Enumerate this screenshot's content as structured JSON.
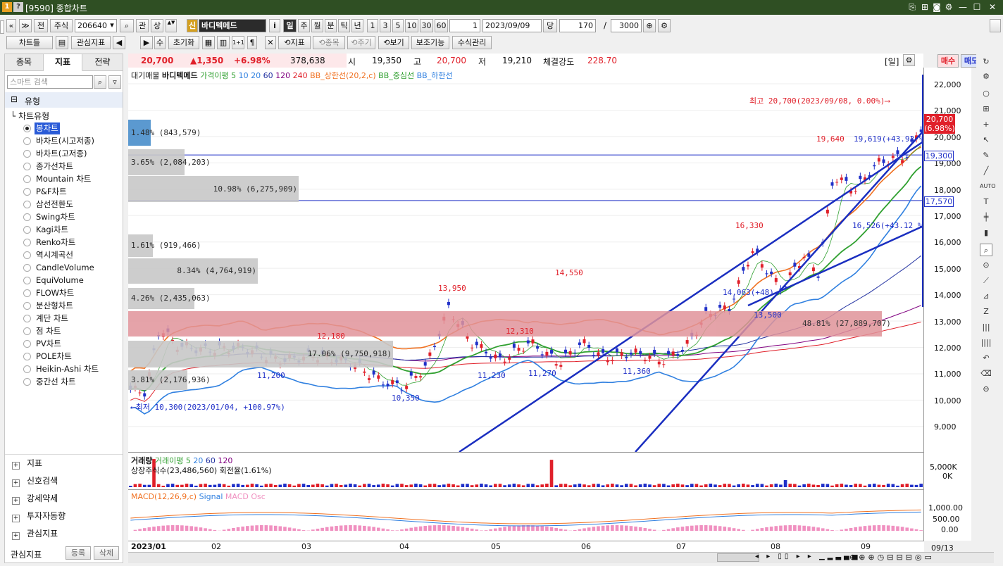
{
  "window": {
    "badge1": "1",
    "badge2": "?",
    "title": "[9590] 종합차트",
    "controls": [
      "⎘",
      "⊞",
      "◙",
      "⚙",
      "—",
      "☐",
      "✕"
    ]
  },
  "toolbar1": {
    "prev_label": "«",
    "up_label": "≫",
    "jeon": "전",
    "jusik": "주식",
    "code": "206640",
    "search_icon_label": "⌕",
    "gwan": "관",
    "sang": "상",
    "stepper": "▲▼",
    "sin": "신",
    "name": "바디텍메드",
    "info": "i",
    "periods": [
      "일",
      "주",
      "월",
      "분",
      "틱",
      "년"
    ],
    "nums": [
      "1",
      "3",
      "5",
      "10",
      "30",
      "60"
    ],
    "period_val": "1",
    "date": "2023/09/09",
    "dang": "당",
    "count": "170",
    "slash": "/",
    "max": "3000"
  },
  "toolbar2": {
    "charttool": "차트틀",
    "save_icon": "▤",
    "interest": "관심지표",
    "left_arrow": "◀",
    "right_arrow": "▶",
    "su": "수",
    "reset": "초기화",
    "grid1": "▦",
    "grid2": "▥",
    "grid3": "1+1",
    "x": "✕",
    "indicator": "지표",
    "item": "종목",
    "cycle": "주기",
    "view": "보기",
    "assist": "보조기능",
    "formula": "수식관리"
  },
  "left": {
    "tabs": [
      "종목",
      "지표",
      "전략"
    ],
    "search_placeholder": "스마트 검색",
    "type_header": "유형",
    "chart_type_label": "차트유형",
    "chart_types": [
      "봉차트",
      "바차트(시고저종)",
      "바차트(고저종)",
      "종가선차트",
      "Mountain 차트",
      "P&F차트",
      "삼선전환도",
      "Swing차트",
      "Kagi차트",
      "Renko차트",
      "역시계곡선",
      "CandleVolume",
      "EquiVolume",
      "FLOW차트",
      "분산형차트",
      "계단 차트",
      "점 차트",
      "PV차트",
      "POLE차트",
      "Heikin-Ashi 차트",
      "중간선 차트"
    ],
    "trees": [
      "지표",
      "신호검색",
      "강세약세",
      "투자자동향",
      "관심지표"
    ],
    "bottom_label": "관심지표",
    "reg": "등록",
    "del": "삭제"
  },
  "quote": {
    "price": "20,700",
    "change": "▲1,350",
    "rate": "+6.98%",
    "volume": "378,638",
    "open_l": "시",
    "open": "19,350",
    "high_l": "고",
    "high": "20,700",
    "low_l": "저",
    "low": "19,210",
    "str_l": "체결강도",
    "strength": "228.70",
    "period": "[일]",
    "buy": "매수",
    "sell": "매도"
  },
  "legend_price": {
    "a": "대기매물",
    "b": "바디텍메드",
    "c": "가격이평 5",
    "d": "10",
    "e": "20",
    "f": "60",
    "g": "120",
    "h": "240",
    "i": "BB_상한선(20,2,c)",
    "j": "BB_중심선",
    "k": "BB_하한선"
  },
  "annotations": {
    "max_text": "최고 20,700(2023/09/08, 0.00%)⟶",
    "min_text": "⟵최저 10,300(2023/01/04, +100.97%)",
    "p19640": "19,640",
    "p19619": "19,619(+43.93 %)",
    "p16526": "16,526(+43.12 %)",
    "p16330": "16,330",
    "p14550": "14,550",
    "p13950": "13,950",
    "p14063": "14,063(+48)",
    "p13500": "13,500",
    "p12310": "12,310",
    "p12180": "12,180",
    "p11200": "11,200",
    "p11230": "11,230",
    "p11270": "11,270",
    "p11360": "11,360",
    "p10350": "10,350"
  },
  "volume_profile": [
    {
      "label": "1.48% (843,579)",
      "w": 32,
      "color": "#4a8fcc"
    },
    {
      "label": "3.65% (2,084,203)",
      "w": 80,
      "color": "#c8c8c8"
    },
    {
      "label": "10.98% (6,275,909)",
      "w": 242,
      "color": "#c8c8c8"
    },
    {
      "label": "1.61% (919,466)",
      "w": 35,
      "color": "#c8c8c8"
    },
    {
      "label": "8.34% (4,764,919)",
      "w": 184,
      "color": "#c8c8c8"
    },
    {
      "label": "4.26% (2,435,063)",
      "w": 94,
      "color": "#c8c8c8"
    },
    {
      "label": "48.81% (27,889,707)",
      "w": 1070,
      "color": "#e0939a"
    },
    {
      "label": "17.06% (9,750,918)",
      "w": 376,
      "color": "#c8c8c8"
    },
    {
      "label": "3.81% (2,176,936)",
      "w": 84,
      "color": "#c8c8c8"
    }
  ],
  "y_ticks": [
    "22,000",
    "21,000",
    "20,000",
    "19,000",
    "18,000",
    "17,000",
    "16,000",
    "15,000",
    "14,000",
    "13,000",
    "12,000",
    "11,000",
    "10,000",
    "9,000"
  ],
  "y_tags": {
    "last": "20,700",
    "last_rate": "(6.98%)",
    "h1": "19,300",
    "h2": "17,570"
  },
  "volume_panel": {
    "a": "거래량",
    "b": "거래이평 5",
    "c": "20",
    "d": "60",
    "e": "120",
    "info": "상장주식수(23,486,560) 회전율(1.61%)",
    "ticks": [
      "5,000K",
      "0K"
    ]
  },
  "macd_panel": {
    "a": "MACD(12,26,9,c)",
    "b": "Signal",
    "c": "MACD Osc",
    "ticks": [
      "1,000.00",
      "500.00",
      "0.00"
    ]
  },
  "x_labels": [
    "2023/01",
    "02",
    "03",
    "04",
    "05",
    "06",
    "07",
    "08",
    "09"
  ],
  "x_right": "09/13",
  "colors": {
    "up": "#e0202a",
    "down": "#2030c8",
    "ma5": "#30a030",
    "ma20": "#2030a0",
    "bb": "#f07020",
    "bblow": "#3080e0"
  }
}
